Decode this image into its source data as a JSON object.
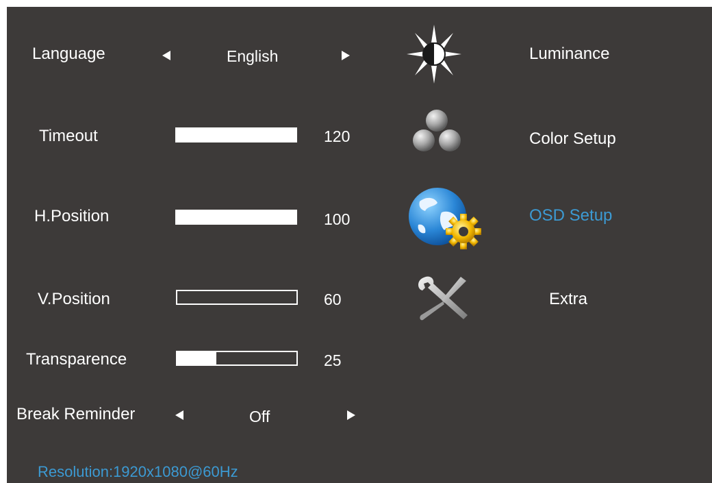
{
  "settings": {
    "language": {
      "label": "Language",
      "value": "English"
    },
    "timeout": {
      "label": "Timeout",
      "value": "120",
      "level": 1.0
    },
    "h_position": {
      "label": "H.Position",
      "value": "100",
      "level": 1.0
    },
    "v_position": {
      "label": "V.Position",
      "value": "60",
      "level": 0.0
    },
    "transparence": {
      "label": "Transparence",
      "value": "25",
      "level": 0.33
    },
    "break_reminder": {
      "label": "Break Reminder",
      "value": "Off"
    }
  },
  "menu": {
    "items": [
      {
        "label": "Luminance",
        "icon": "luminance-icon"
      },
      {
        "label": "Color Setup",
        "icon": "color-setup-icon"
      },
      {
        "label": "OSD Setup",
        "icon": "osd-setup-icon",
        "active": true
      },
      {
        "label": "Extra",
        "icon": "extra-icon"
      }
    ]
  },
  "status": {
    "resolution": "Resolution:1920x1080@60Hz"
  },
  "colors": {
    "background": "#3d3a39",
    "text": "#ffffff",
    "accent": "#3c9ad3"
  }
}
